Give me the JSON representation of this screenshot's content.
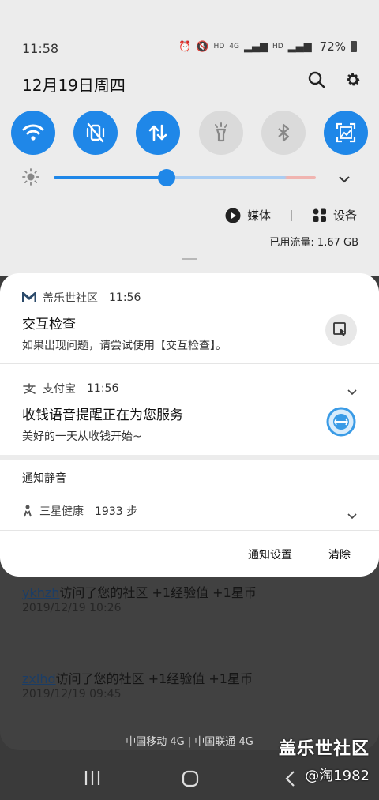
{
  "status_bar": {
    "time": "11:58",
    "network_a": "HD",
    "network_b": "4G",
    "network_c": "HD",
    "battery": "72%"
  },
  "quick_panel": {
    "date": "12月19日周四",
    "media_label": "媒体",
    "devices_label": "设备",
    "data_usage": "已用流量: 1.67 GB",
    "brightness_level": 0.43
  },
  "notifications": [
    {
      "app": "盖乐世社区",
      "time": "11:56",
      "title": "交互检查",
      "body": "如果出现问题，请尝试使用【交互检查】。"
    },
    {
      "app": "支付宝",
      "time": "11:56",
      "title": "收钱语音提醒正在为您服务",
      "body": "美好的一天从收钱开始~"
    }
  ],
  "silent_section": {
    "label": "通知静音",
    "app": "三星健康",
    "detail": "1933 步"
  },
  "footer": {
    "settings": "通知设置",
    "clear": "清除"
  },
  "background_feed": [
    {
      "user": "ykhzh",
      "text": "访问了您的社区 +1经验值 +1星币",
      "date": "2019/12/19 10:26"
    },
    {
      "user": "zxlhd",
      "text": "访问了您的社区 +1经验值 +1星币",
      "date": "2019/12/19 09:45"
    }
  ],
  "carrier": "中国移动 4G | 中国联通 4G",
  "watermark": {
    "line1": "盖乐世社区",
    "line2": "@淘1982"
  },
  "colors": {
    "accent": "#1f87e8",
    "tile_off": "#dadada",
    "panel_bg": "#ececec"
  }
}
